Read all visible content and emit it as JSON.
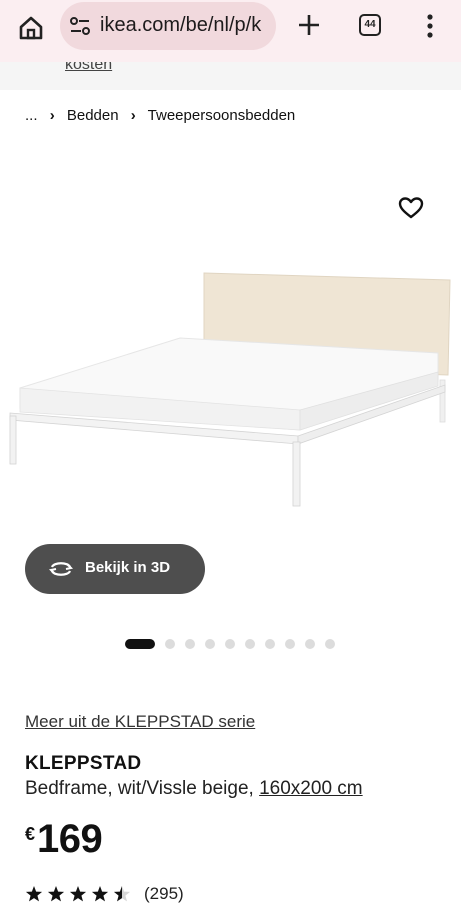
{
  "browser": {
    "url": "ikea.com/be/nl/p/k",
    "tab_count": "44",
    "icons": [
      "home-icon",
      "site-settings-icon",
      "new-tab-plus-icon",
      "tabs-icon",
      "more-menu-icon"
    ]
  },
  "strip": {
    "text": "kosten"
  },
  "breadcrumb": {
    "ellipsis": "...",
    "items": [
      "Bedden",
      "Tweepersoonsbedden"
    ]
  },
  "view3d": {
    "label": "Bekijk in 3D"
  },
  "carousel": {
    "total": 10,
    "active": 1
  },
  "product": {
    "series_link": "Meer uit de KLEPPSTAD serie",
    "name": "KLEPPSTAD",
    "description": "Bedframe, wit/Vissle beige,",
    "size": "160x200 cm",
    "currency": "€",
    "price": "169",
    "rating": 4.5,
    "reviews": "(295)"
  },
  "colors": {
    "toolbar": "#fbeef1",
    "url_pill": "#f1d9dd",
    "button_3d": "#4e4e4e",
    "headboard": "#efe5d4"
  }
}
